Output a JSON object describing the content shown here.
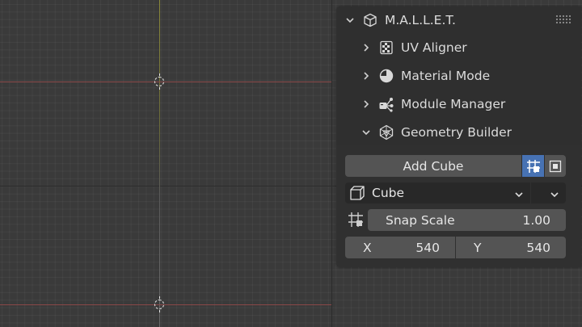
{
  "panel": {
    "addon_title": "M.A.L.L.E.T.",
    "sections": [
      {
        "label": "UV Aligner",
        "expanded": false,
        "icon": "checker-icon"
      },
      {
        "label": "Material Mode",
        "expanded": false,
        "icon": "material-sphere-icon"
      },
      {
        "label": "Module Manager",
        "expanded": false,
        "icon": "node-tree-icon"
      },
      {
        "label": "Geometry Builder",
        "expanded": true,
        "icon": "mesh-icon"
      }
    ],
    "geometry_builder": {
      "add_button_label": "Add Cube",
      "shape_select": {
        "value": "Cube",
        "icon": "cube-icon"
      },
      "snap_scale": {
        "label": "Snap Scale",
        "value": "1.00"
      },
      "x": {
        "label": "X",
        "value": "540"
      },
      "y": {
        "label": "Y",
        "value": "540"
      }
    }
  },
  "colors": {
    "accent": "#4772b3",
    "x_axis": "#8a4848",
    "y_axis": "#8c8a3a"
  }
}
